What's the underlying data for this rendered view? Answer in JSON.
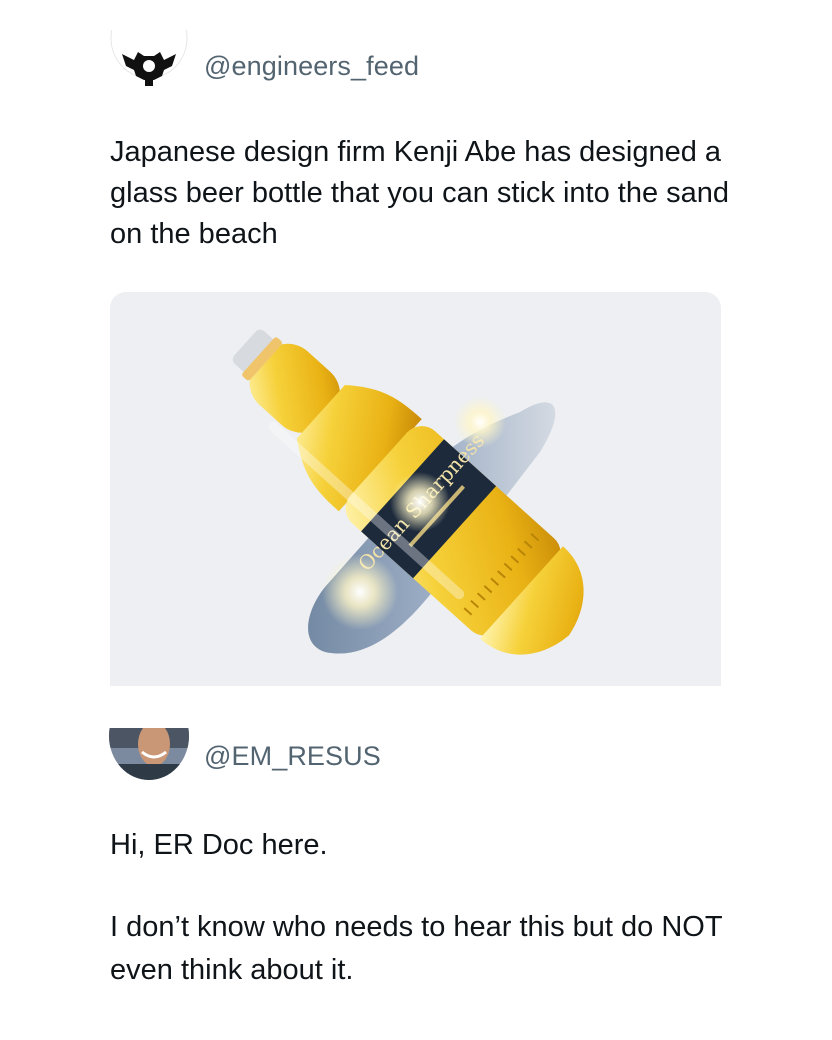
{
  "post1": {
    "author_handle": "@engineers_feed",
    "avatar_icon": "gear-logo-icon",
    "text": "Japanese design firm Kenji Abe has designed a glass beer bottle that you can stick into the sand on the beach",
    "media": {
      "bottle_label_text": "Ocean Sharpness",
      "colors": {
        "background": "#edeff2",
        "beer": "#f2c21d",
        "label": "#1d2a3c",
        "shadow": "#6e86a6"
      }
    }
  },
  "post2": {
    "author_handle": "@EM_RESUS",
    "avatar_icon": "user-photo-avatar",
    "paragraphs": [
      "Hi, ER Doc here.",
      "I don’t know who needs to hear this but do NOT even think about it."
    ]
  }
}
